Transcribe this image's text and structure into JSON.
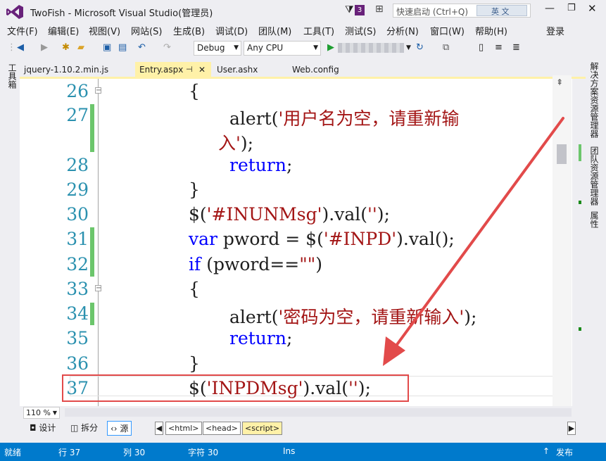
{
  "window": {
    "title": "TwoFish - Microsoft Visual Studio(管理员)",
    "notification_count": "3",
    "quick_launch_placeholder": "快速启动 (Ctrl+Q)",
    "ime_label": "英 文"
  },
  "menu": [
    "文件(F)",
    "编辑(E)",
    "视图(V)",
    "网站(S)",
    "生成(B)",
    "调试(D)",
    "团队(M)",
    "工具(T)",
    "测试(S)",
    "分析(N)",
    "窗口(W)",
    "帮助(H)"
  ],
  "login_label": "登录",
  "toolbar": {
    "configuration": "Debug",
    "platform": "Any CPU"
  },
  "left_panel": {
    "toolbox": "工具箱"
  },
  "right_panel": [
    "解决方案资源管理器",
    "团队资源管理器",
    "属性"
  ],
  "tabs": [
    {
      "label": "jquery-1.10.2.min.js",
      "active": false
    },
    {
      "label": "Entry.aspx",
      "active": true
    },
    {
      "label": "User.ashx",
      "active": false
    },
    {
      "label": "Web.config",
      "active": false
    }
  ],
  "editor": {
    "line_numbers": [
      "26",
      "27",
      "28",
      "29",
      "30",
      "31",
      "32",
      "33",
      "34",
      "35",
      "36",
      "37"
    ],
    "code": {
      "l26": "{",
      "l27a_fn": "alert(",
      "l27a_str": "'用户名为空，请重新输",
      "l27b_str": "入'",
      "l27b_end": ");",
      "l28": "return",
      "l28_end": ";",
      "l29": "}",
      "l30_pre": "$(",
      "l30_str": "'#INUNMsg'",
      "l30_mid": ").val(",
      "l30_str2": "''",
      "l30_end": ");",
      "l31_kw": "var",
      "l31_mid": " pword = $(",
      "l31_str": "'#INPD'",
      "l31_end": ").val();",
      "l32_kw": "if",
      "l32_mid": " (pword==",
      "l32_str": "\"\"",
      "l32_end": ")",
      "l33": "{",
      "l34_fn": "alert(",
      "l34_str": "'密码为空，请重新输入'",
      "l34_end": ");",
      "l35": "return",
      "l35_end": ";",
      "l36": "}",
      "l37_pre": "$(",
      "l37_str": "'INPDMsg'",
      "l37_mid": ").val(",
      "l37_str2": "''",
      "l37_end": ");"
    }
  },
  "zoom": "110 %",
  "view_bar": {
    "design": "设计",
    "split": "拆分",
    "source": "源",
    "crumbs": [
      "<html>",
      "<head>",
      "<script>"
    ]
  },
  "status": {
    "ready": "就绪",
    "line": "行 37",
    "col": "列 30",
    "char": "字符 30",
    "mode": "Ins",
    "publish": "发布"
  },
  "colors": {
    "accent": "#007acc",
    "active_tab": "#fff1a8",
    "keyword": "#0000ff",
    "string": "#a31515",
    "line_number": "#2b91af",
    "annotation": "#e24a4a"
  }
}
